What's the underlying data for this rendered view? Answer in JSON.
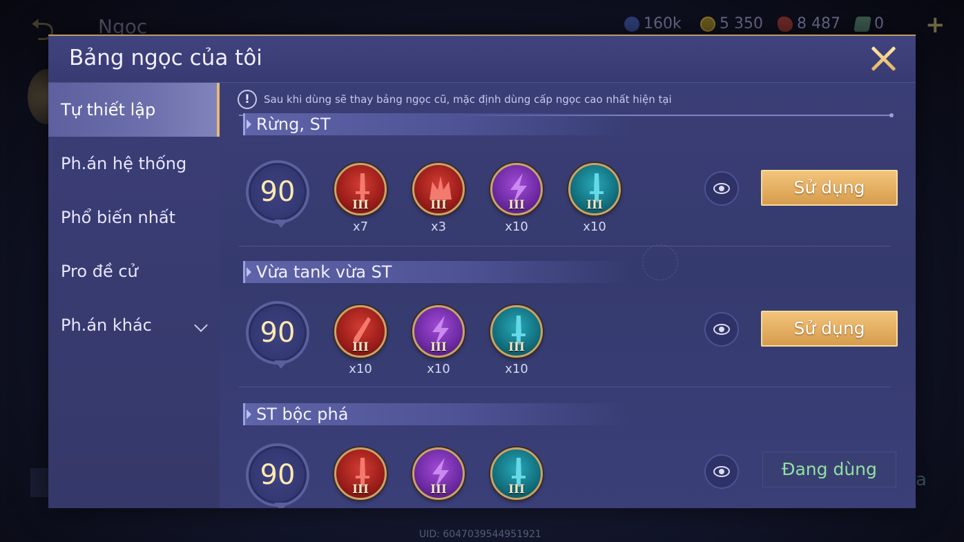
{
  "background": {
    "title": "Ngọc",
    "resources": [
      {
        "icon": "blue-coin-icon",
        "value": "160k"
      },
      {
        "icon": "gold-coin-icon",
        "value": "5 350"
      },
      {
        "icon": "red-gem-icon",
        "value": "8 487"
      },
      {
        "icon": "ticket-icon",
        "value": "0"
      }
    ],
    "plus": "+",
    "uid": "UID: 6047039544951921",
    "right_fragment": "a"
  },
  "modal": {
    "title": "Bảng ngọc của tôi",
    "close_icon": "close-icon"
  },
  "sidebar": {
    "items": [
      {
        "label": "Tự thiết lập",
        "active": true
      },
      {
        "label": "Ph.án hệ thống"
      },
      {
        "label": "Phổ biến nhất"
      },
      {
        "label": "Pro đề cử"
      },
      {
        "label": "Ph.án khác"
      }
    ]
  },
  "notice": {
    "icon": "!",
    "text": "Sau khi dùng sẽ thay bảng ngọc cũ, mặc định dùng cấp ngọc cao nhất hiện tại"
  },
  "sets": [
    {
      "name": "Rừng, ST",
      "level": "90",
      "gems": [
        {
          "color": "red",
          "icon": "sword-icon",
          "tier": "III",
          "count": "x7"
        },
        {
          "color": "red",
          "icon": "crown-icon",
          "tier": "III",
          "count": "x3"
        },
        {
          "color": "purple",
          "icon": "lightning-icon",
          "tier": "III",
          "count": "x10"
        },
        {
          "color": "teal",
          "icon": "sword-icon",
          "tier": "III",
          "count": "x10"
        }
      ],
      "action": "Sử dụng"
    },
    {
      "name": "Vừa tank vừa ST",
      "level": "90",
      "gems": [
        {
          "color": "red",
          "icon": "blade-icon",
          "tier": "III",
          "count": "x10"
        },
        {
          "color": "purple",
          "icon": "lightning-icon",
          "tier": "III",
          "count": "x10"
        },
        {
          "color": "teal",
          "icon": "sword-icon",
          "tier": "III",
          "count": "x10"
        }
      ],
      "action": "Sử dụng"
    },
    {
      "name": "ST bộc phá",
      "level": "90",
      "gems": [
        {
          "color": "red",
          "icon": "sword-icon",
          "tier": "III",
          "count": ""
        },
        {
          "color": "purple",
          "icon": "lightning-icon",
          "tier": "III",
          "count": ""
        },
        {
          "color": "teal",
          "icon": "sword-icon",
          "tier": "III",
          "count": ""
        }
      ],
      "action": "Đang dùng"
    }
  ]
}
